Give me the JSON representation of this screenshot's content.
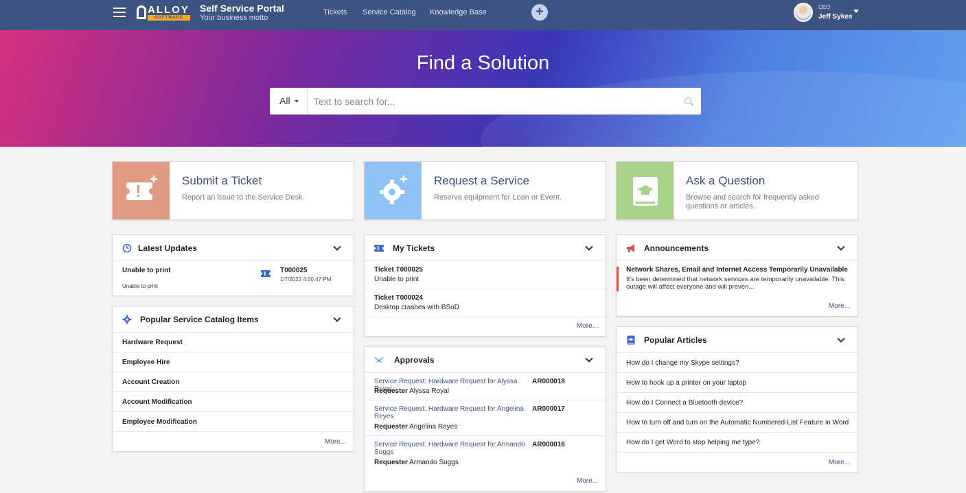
{
  "header": {
    "logo_top": "ALLOY",
    "logo_bottom": "SOFTWARE",
    "title": "Self Service Portal",
    "motto": "Your business motto",
    "nav": [
      "Tickets",
      "Service Catalog",
      "Knowledge Base"
    ],
    "plus": "+",
    "user_role": "CEO",
    "user_name": "Jeff Sykes"
  },
  "hero": {
    "title": "Find a Solution",
    "scope": "All",
    "search_placeholder": "Text to search for..."
  },
  "actions": [
    {
      "title": "Submit a Ticket",
      "desc": "Report an issue to the Service Desk.",
      "color": "#e09a82",
      "icon": "ticket-plus-icon"
    },
    {
      "title": "Request a Service",
      "desc": "Reserve equipment for Loan or Event.",
      "color": "#8fc3f5",
      "icon": "gear-plus-icon"
    },
    {
      "title": "Ask a Question",
      "desc": "Browse and search for frequently asked questions or articles.",
      "color": "#a8d28a",
      "icon": "book-icon"
    }
  ],
  "latest_updates": {
    "title": "Latest Updates",
    "items": [
      {
        "subject": "Unable to print",
        "sub": "Unable to print",
        "id": "T000025",
        "date": "1/7/2022 4:00:47 PM"
      }
    ]
  },
  "catalog": {
    "title": "Popular Service Catalog Items",
    "items": [
      "Hardware Request",
      "Employee Hire",
      "Account Creation",
      "Account Modification",
      "Employee Modification"
    ],
    "more": "More..."
  },
  "tickets": {
    "title": "My Tickets",
    "items": [
      {
        "id": "Ticket T000025",
        "subject": "Unable to print"
      },
      {
        "id": "Ticket T000024",
        "subject": "Desktop crashes with BSoD"
      }
    ],
    "more": "More..."
  },
  "approvals": {
    "title": "Approvals",
    "requester_label": "Requester",
    "items": [
      {
        "title": "Service Request: Hardware Request for Alyssa Royal",
        "id": "AR000018",
        "requester": "Alyssa Royal"
      },
      {
        "title": "Service Request: Hardware Request for Angelina Reyes",
        "id": "AR000017",
        "requester": "Angelina Reyes"
      },
      {
        "title": "Service Request: Hardware Request for Armando Suggs",
        "id": "AR000016",
        "requester": "Armando Suggs"
      }
    ],
    "more": "More..."
  },
  "announcements": {
    "title": "Announcements",
    "item_title": "Network Shares, Email and Internet Access Temporarily Unavailable",
    "item_text": "It's been determined that network services are temporarily unavailable. This outage will affect everyone and will preven...",
    "more": "More..."
  },
  "articles": {
    "title": "Popular Articles",
    "items": [
      "How do I change my Skype settings?",
      "How to hook up a printer on your laptop",
      "How do I Connect a Bluetooth device?",
      "How to turn off and turn on the Automatic Numbered-List Feature in Word",
      "How do I get Word to stop helping me type?"
    ],
    "more": "More..."
  }
}
